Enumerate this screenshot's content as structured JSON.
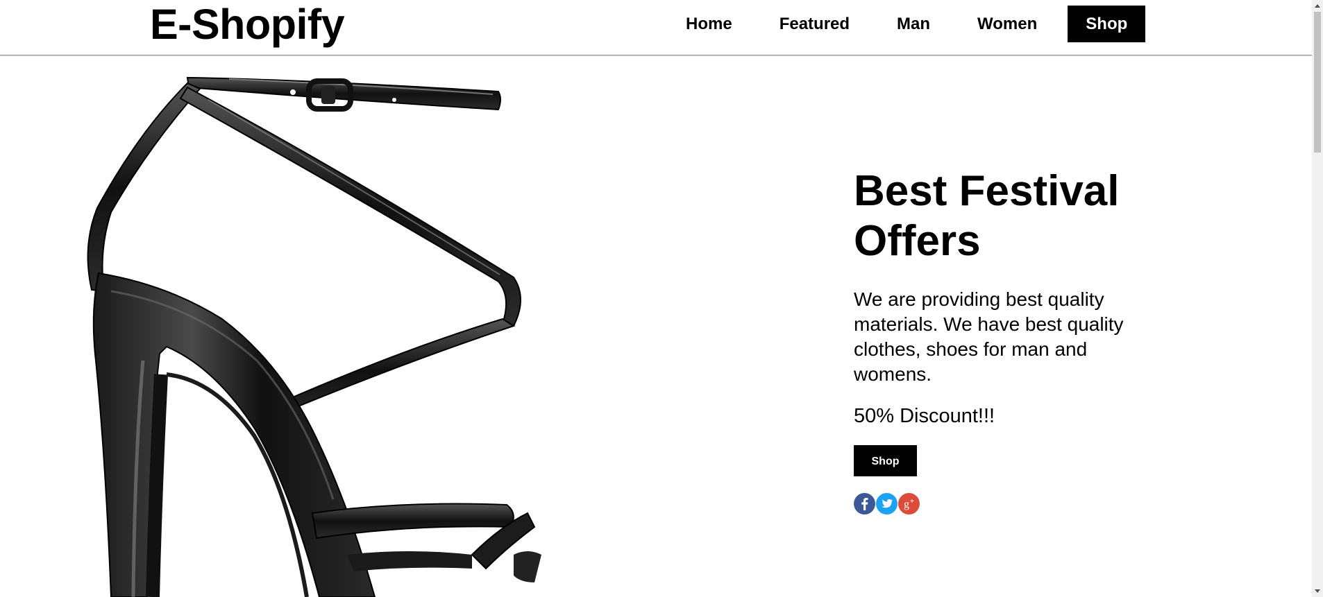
{
  "header": {
    "logo": "E-Shopify",
    "nav": [
      {
        "label": "Home"
      },
      {
        "label": "Featured"
      },
      {
        "label": "Man"
      },
      {
        "label": "Women"
      },
      {
        "label": "Shop",
        "active": true
      }
    ]
  },
  "hero": {
    "image_subject": "black patent strappy high heel sandal",
    "title": "Best Festival Offers",
    "description": "We are providing best quality materials. We have best quality clothes, shoes for man and womens.",
    "discount": "50% Discount!!!",
    "button_label": "Shop",
    "social": [
      {
        "icon": "facebook-icon",
        "glyph": "f",
        "color": "#3b5998"
      },
      {
        "icon": "twitter-icon",
        "glyph": "bird",
        "color": "#1da1f2"
      },
      {
        "icon": "google-plus-icon",
        "glyph": "g+",
        "color": "#dd4b39"
      }
    ]
  },
  "colors": {
    "accent": "#000000",
    "background": "#ffffff"
  }
}
